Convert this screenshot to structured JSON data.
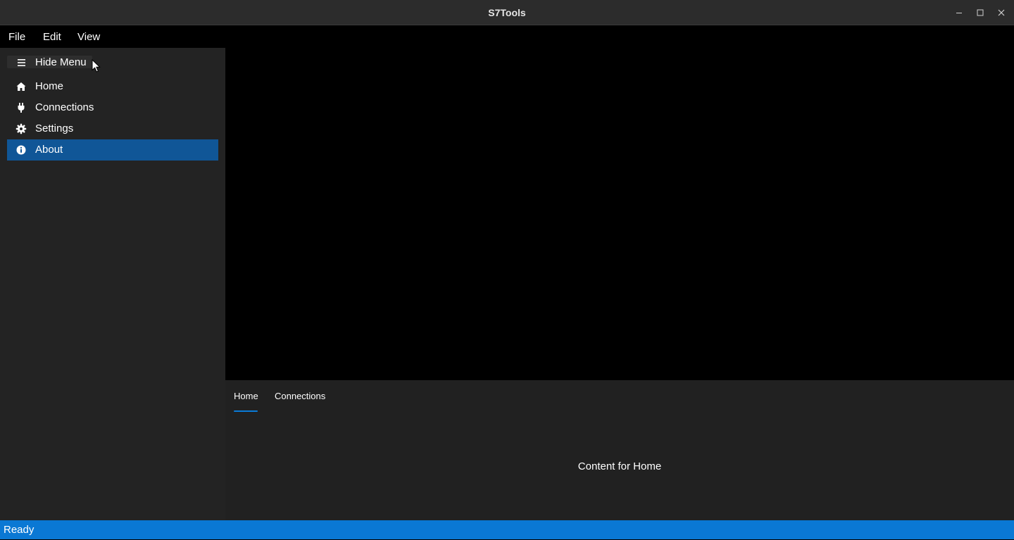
{
  "window": {
    "title": "S7Tools",
    "controls": [
      "minimize-icon",
      "maximize-icon",
      "close-icon"
    ]
  },
  "menubar": {
    "items": [
      "File",
      "Edit",
      "View"
    ]
  },
  "sidebar": {
    "toggle_label": "Hide Menu",
    "toggle_icon": "hamburger-icon",
    "items": [
      {
        "label": "Home",
        "icon": "home-icon",
        "selected": false
      },
      {
        "label": "Connections",
        "icon": "plug-icon",
        "selected": false
      },
      {
        "label": "Settings",
        "icon": "gear-icon",
        "selected": false
      },
      {
        "label": "About",
        "icon": "info-icon",
        "selected": true
      }
    ]
  },
  "bottom_panel": {
    "tabs": [
      {
        "label": "Home",
        "active": true
      },
      {
        "label": "Connections",
        "active": false
      }
    ],
    "content": "Content for Home"
  },
  "statusbar": {
    "text": "Ready"
  },
  "colors": {
    "accent": "#0a78d4",
    "selected_item": "#105697",
    "sidebar_bg": "#232323",
    "panel_bg": "#212121",
    "titlebar_bg": "#2c2c2c"
  }
}
